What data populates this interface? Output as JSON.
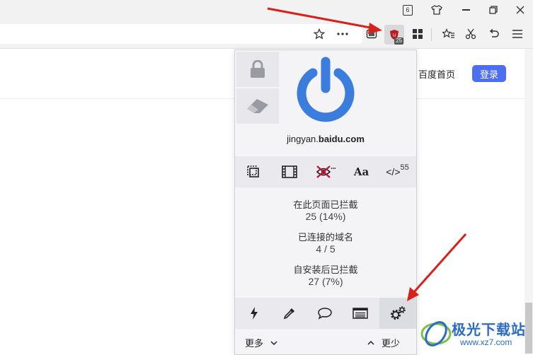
{
  "titlebar": {
    "tab_count_badge": "6",
    "icons": [
      "tab-count-icon",
      "shirt-skin-icon",
      "minimize-icon",
      "restore-icon",
      "close-icon"
    ]
  },
  "toolbar": {
    "extension_badge": "25",
    "icons": [
      "star-icon",
      "more-icon",
      "shield-box-icon",
      "ublock-icon",
      "apps-grid-icon",
      "favorites-icon",
      "scissors-icon",
      "undo-icon",
      "menu-icon"
    ]
  },
  "page": {
    "baidu_home_link": "百度首页",
    "login_button": "登录"
  },
  "popup": {
    "hostname_prefix": "jingyan.",
    "hostname_domain": "baidu.com",
    "tools": {
      "font_label": "Aa",
      "script_label": "</>",
      "script_count": "55"
    },
    "stats": {
      "blocked_on_page_label": "在此页面已拦截",
      "blocked_on_page_value": "25 (14%)",
      "domains_connected_label": "已连接的域名",
      "domains_connected_value": "4 / 5",
      "blocked_since_install_label": "自安装后已拦截",
      "blocked_since_install_value": "27 (7%)"
    },
    "more_label": "更多",
    "less_label": "更少"
  },
  "watermark": {
    "text": "极光下载站",
    "url": "www.xz7.com"
  },
  "colors": {
    "accent_blue": "#3b7ddd",
    "login_blue": "#4e6ef2",
    "arrow_red": "#d9211c",
    "ublock_red": "#b81e1e"
  }
}
